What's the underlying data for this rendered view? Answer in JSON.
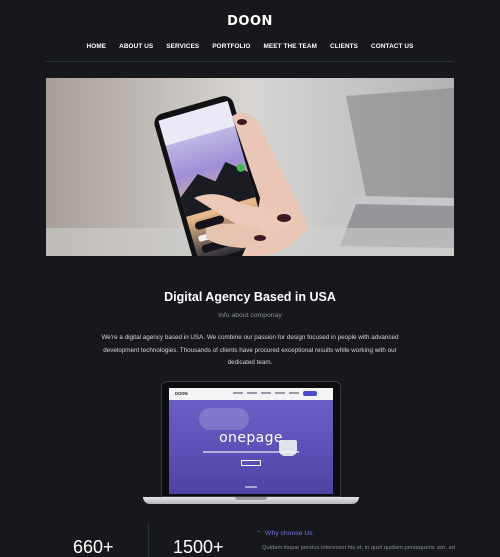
{
  "header": {
    "logo": "DOON",
    "nav": [
      "HOME",
      "ABOUT US",
      "SERVICES",
      "PORTFOLIO",
      "MEET THE TEAM",
      "CLIENTS",
      "CONTACT US"
    ]
  },
  "about": {
    "title": "Digital Agency Based in USA",
    "subtitle": "Info about componay",
    "body": "We're a digital agency based in USA. We combine our passion for design focused in people with advanced development technologies. Thousands of clients have procured exceptional results while working with our dedicated team."
  },
  "laptop_screen": {
    "logo": "DOON",
    "title": "onepage"
  },
  "stats": [
    {
      "value": "660+"
    },
    {
      "value": "1500+"
    }
  ],
  "why": {
    "label": "Why choose Us",
    "text": "Quidam lisque persius interesset his et, in quot quidam persequeris vim, ad"
  },
  "colors": {
    "background": "#16181b",
    "accent": "#7b6ee0",
    "screen_purple": "#5a4fb0"
  }
}
